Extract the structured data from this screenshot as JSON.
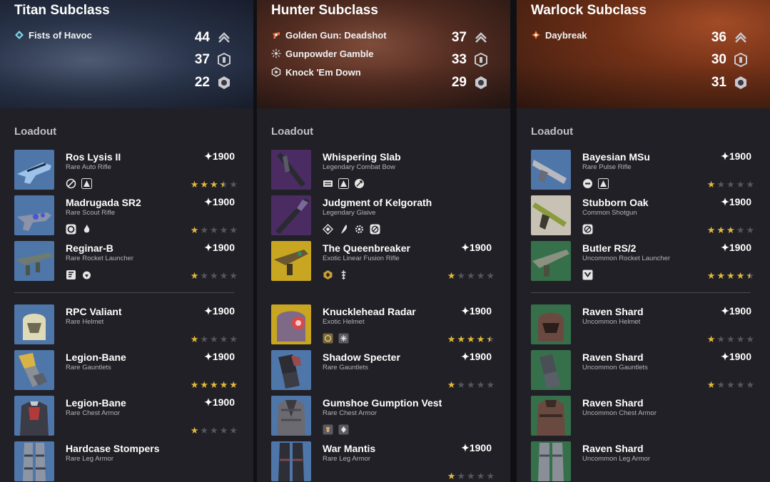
{
  "columns": [
    {
      "title": "Titan Subclass",
      "hero_style": "titan",
      "abilities": [
        {
          "label": "Fists of Havoc",
          "icon": "diamond-icon",
          "color": "#7fd3e6"
        }
      ],
      "stats": [
        {
          "value": "44",
          "icon": "mobility-icon"
        },
        {
          "value": "37",
          "icon": "resilience-icon"
        },
        {
          "value": "22",
          "icon": "recovery-icon"
        }
      ],
      "loadout_label": "Loadout",
      "items": [
        {
          "name": "Ros Lysis II",
          "type": "Rare Auto Rifle",
          "power": "✦1900",
          "rarity": "rare",
          "stars": 3.5,
          "mods": [
            "circle-slash-icon",
            "triangle-icon"
          ]
        },
        {
          "name": "Madrugada SR2",
          "type": "Rare Scout Rifle",
          "power": "✦1900",
          "rarity": "rare",
          "stars": 1,
          "mods": [
            "ring-icon",
            "flame-icon"
          ]
        },
        {
          "name": "Reginar-B",
          "type": "Rare Rocket Launcher",
          "power": "✦1900",
          "rarity": "rare",
          "stars": 1,
          "mods": [
            "page-icon",
            "bomb-icon"
          ]
        },
        {
          "name": "RPC Valiant",
          "type": "Rare Helmet",
          "power": "✦1900",
          "rarity": "rare",
          "stars": 1,
          "mods": []
        },
        {
          "name": "Legion-Bane",
          "type": "Rare Gauntlets",
          "power": "✦1900",
          "rarity": "rare",
          "stars": 5,
          "mods": []
        },
        {
          "name": "Legion-Bane",
          "type": "Rare Chest Armor",
          "power": "✦1900",
          "rarity": "rare",
          "stars": 1,
          "mods": []
        },
        {
          "name": "Hardcase Stompers",
          "type": "Rare Leg Armor",
          "power": "",
          "rarity": "rare",
          "stars": 0,
          "mods": []
        }
      ]
    },
    {
      "title": "Hunter Subclass",
      "hero_style": "hunter",
      "abilities": [
        {
          "label": "Golden Gun: Deadshot",
          "icon": "golden-gun-icon",
          "color": "#e8703a"
        },
        {
          "label": "Gunpowder Gamble",
          "icon": "burst-icon",
          "color": "#d0d0d0"
        },
        {
          "label": "Knock 'Em Down",
          "icon": "hexagon-icon",
          "color": "#d0d0d0"
        }
      ],
      "stats": [
        {
          "value": "37",
          "icon": "mobility-icon"
        },
        {
          "value": "33",
          "icon": "resilience-icon"
        },
        {
          "value": "29",
          "icon": "recovery-icon"
        }
      ],
      "loadout_label": "Loadout",
      "items": [
        {
          "name": "Whispering Slab",
          "type": "Legendary Combat Bow",
          "power": "",
          "rarity": "legendary",
          "stars": 0,
          "mods": [
            "bars-icon",
            "triangle-icon",
            "arrow-icon"
          ]
        },
        {
          "name": "Judgment of Kelgorath",
          "type": "Legendary Glaive",
          "power": "",
          "rarity": "legendary",
          "stars": 0,
          "mods": [
            "diamond-icon",
            "blade-icon",
            "gear-icon",
            "circle-slash-icon"
          ]
        },
        {
          "name": "The Queenbreaker",
          "type": "Exotic Linear Fusion Rifle",
          "power": "✦1900",
          "rarity": "exotic",
          "stars": 1,
          "mods": [
            "hex-gold-icon",
            "antenna-icon"
          ]
        },
        {
          "name": "Knucklehead Radar",
          "type": "Exotic Helmet",
          "power": "✦1900",
          "rarity": "exotic",
          "stars": 4.5,
          "mods": [
            "mod-box-icon",
            "mod-box-icon"
          ]
        },
        {
          "name": "Shadow Specter",
          "type": "Rare Gauntlets",
          "power": "✦1900",
          "rarity": "rare",
          "stars": 1,
          "mods": []
        },
        {
          "name": "Gumshoe Gumption Vest",
          "type": "Rare Chest Armor",
          "power": "",
          "rarity": "rare",
          "stars": 0,
          "mods": [
            "mod-box-icon",
            "mod-box-icon"
          ]
        },
        {
          "name": "War Mantis",
          "type": "Rare Leg Armor",
          "power": "✦1900",
          "rarity": "rare",
          "stars": 1,
          "mods": []
        }
      ]
    },
    {
      "title": "Warlock Subclass",
      "hero_style": "warlock",
      "abilities": [
        {
          "label": "Daybreak",
          "icon": "sun-icon",
          "color": "#e8703a"
        }
      ],
      "stats": [
        {
          "value": "36",
          "icon": "mobility-icon"
        },
        {
          "value": "30",
          "icon": "resilience-icon"
        },
        {
          "value": "31",
          "icon": "recovery-icon"
        }
      ],
      "loadout_label": "Loadout",
      "items": [
        {
          "name": "Bayesian MSu",
          "type": "Rare Pulse Rifle",
          "power": "✦1900",
          "rarity": "rare",
          "stars": 1,
          "mods": [
            "ring-icon",
            "triangle-icon"
          ]
        },
        {
          "name": "Stubborn Oak",
          "type": "Common Shotgun",
          "power": "✦1900",
          "rarity": "common",
          "stars": 3,
          "mods": [
            "circle-slash-icon"
          ]
        },
        {
          "name": "Butler RS/2",
          "type": "Uncommon Rocket Launcher",
          "power": "✦1900",
          "rarity": "uncommon",
          "stars": 4.5,
          "mods": [
            "wings-icon"
          ]
        },
        {
          "name": "Raven Shard",
          "type": "Uncommon Helmet",
          "power": "✦1900",
          "rarity": "uncommon",
          "stars": 1,
          "mods": []
        },
        {
          "name": "Raven Shard",
          "type": "Uncommon Gauntlets",
          "power": "✦1900",
          "rarity": "uncommon",
          "stars": 1,
          "mods": []
        },
        {
          "name": "Raven Shard",
          "type": "Uncommon Chest Armor",
          "power": "",
          "rarity": "uncommon",
          "stars": 0,
          "mods": []
        },
        {
          "name": "Raven Shard",
          "type": "Uncommon Leg Armor",
          "power": "",
          "rarity": "uncommon",
          "stars": 0,
          "mods": []
        }
      ]
    }
  ]
}
